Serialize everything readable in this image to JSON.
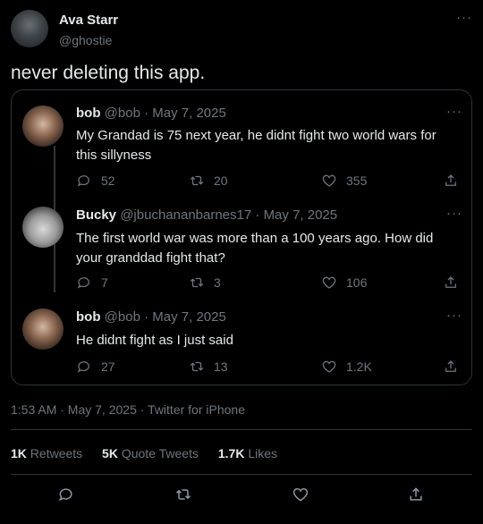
{
  "author": {
    "name": "Ava Starr",
    "handle": "@ghostie"
  },
  "tweet_text": "never deleting this app.",
  "replies": [
    {
      "name": "bob",
      "handle": "@bob",
      "date": "May 7, 2025",
      "text": "My Grandad is 75 next year, he didnt fight two world wars for this sillyness",
      "replies": "52",
      "retweets": "20",
      "likes": "355"
    },
    {
      "name": "Bucky",
      "handle": "@jbuchananbarnes17",
      "date": "May 7, 2025",
      "text": "The first world war was more than a 100 years ago. How did your granddad fight that?",
      "replies": "7",
      "retweets": "3",
      "likes": "106"
    },
    {
      "name": "bob",
      "handle": "@bob",
      "date": "May 7, 2025",
      "text": "He didnt fight as I just said",
      "replies": "27",
      "retweets": "13",
      "likes": "1.2K"
    }
  ],
  "meta_line": "1:53 AM · May 7, 2025 · Twitter for iPhone",
  "stats": {
    "retweets": {
      "count": "1K",
      "label": "Retweets"
    },
    "quotes": {
      "count": "5K",
      "label": "Quote Tweets"
    },
    "likes": {
      "count": "1.7K",
      "label": "Likes"
    }
  },
  "icons": [
    "more-icon",
    "reply-icon",
    "retweet-icon",
    "like-icon",
    "share-icon"
  ],
  "sep": "·"
}
